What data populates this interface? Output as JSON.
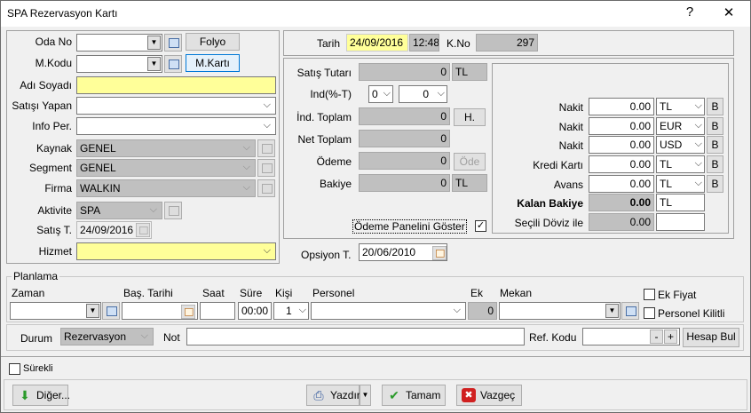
{
  "window": {
    "title": "SPA Rezervasyon Kartı",
    "help_label": "?",
    "close_label": "✕"
  },
  "left": {
    "oda_no_label": "Oda No",
    "oda_no_value": "",
    "folyo_button": "Folyo",
    "mkodu_label": "M.Kodu",
    "mkodu_value": "",
    "mkarti_button": "M.Kartı",
    "adi_soyadi_label": "Adı Soyadı",
    "adi_soyadi_value": "",
    "satisi_yapan_label": "Satışı Yapan",
    "satisi_yapan_value": "",
    "info_per_label": "Info Per.",
    "info_per_value": "",
    "kaynak_label": "Kaynak",
    "kaynak_value": "GENEL",
    "segment_label": "Segment",
    "segment_value": "GENEL",
    "firma_label": "Firma",
    "firma_value": "WALKIN",
    "aktivite_label": "Aktivite",
    "aktivite_value": "SPA",
    "satis_t_label": "Satış T.",
    "satis_t_value": "24/09/2016",
    "hizmet_label": "Hizmet",
    "hizmet_value": ""
  },
  "header": {
    "tarih_label": "Tarih",
    "tarih_value": "24/09/2016",
    "saat_value": "12:48",
    "kno_label": "K.No",
    "kno_value": "297"
  },
  "totals": {
    "satis_tutari_label": "Satış Tutarı",
    "satis_tutari_value": "0",
    "satis_tutari_currency": "TL",
    "ind_label": "Ind(%-T)",
    "ind_percent": "0",
    "ind_amount": "0",
    "ind_toplam_label": "İnd. Toplam",
    "ind_toplam_value": "0",
    "h_button": "H.",
    "net_toplam_label": "Net Toplam",
    "net_toplam_value": "0",
    "odeme_label": "Ödeme",
    "odeme_value": "0",
    "ode_button": "Öde",
    "bakiye_label": "Bakiye",
    "bakiye_value": "0",
    "bakiye_currency": "TL",
    "odeme_panel_label": "Ödeme Panelini Göster",
    "odeme_panel_checked": true
  },
  "payments": [
    {
      "label": "Nakit",
      "amount": "0.00",
      "currency": "TL",
      "b": "B"
    },
    {
      "label": "Nakit",
      "amount": "0.00",
      "currency": "EUR",
      "b": "B"
    },
    {
      "label": "Nakit",
      "amount": "0.00",
      "currency": "USD",
      "b": "B"
    },
    {
      "label": "Kredi Kartı",
      "amount": "0.00",
      "currency": "TL",
      "b": "B"
    },
    {
      "label": "Avans",
      "amount": "0.00",
      "currency": "TL",
      "b": "B"
    }
  ],
  "kalan": {
    "label": "Kalan Bakiye",
    "value": "0.00",
    "currency": "TL",
    "secili_label": "Seçili Döviz ile",
    "secili_value": "0.00",
    "secili_currency": ""
  },
  "opsiyon": {
    "label": "Opsiyon T.",
    "value": "20/06/2010"
  },
  "planlama": {
    "title": "Planlama",
    "zaman_label": "Zaman",
    "zaman_value": "",
    "bas_tarihi_label": "Baş. Tarihi",
    "bas_tarihi_value": "",
    "saat_label": "Saat",
    "saat_value": "",
    "sure_label": "Süre",
    "sure_value": "00:00",
    "kisi_label": "Kişi",
    "kisi_value": "1",
    "personel_label": "Personel",
    "personel_value": "",
    "ek_label": "Ek",
    "ek_value": "0",
    "mekan_label": "Mekan",
    "mekan_value": "",
    "ek_fiyat_label": "Ek Fiyat",
    "personel_kilitli_label": "Personel Kilitli"
  },
  "durum": {
    "label": "Durum",
    "value": "Rezervasyon",
    "not_label": "Not",
    "not_value": "",
    "ref_kodu_label": "Ref. Kodu",
    "ref_kodu_value": "",
    "minus": "-",
    "plus": "+",
    "hesap_bul_button": "Hesap Bul"
  },
  "surekli_label": "Sürekli",
  "footer": {
    "diger_button": "Diğer...",
    "yazdir_button": "Yazdır",
    "tamam_button": "Tamam",
    "vazgec_button": "Vazgeç"
  }
}
